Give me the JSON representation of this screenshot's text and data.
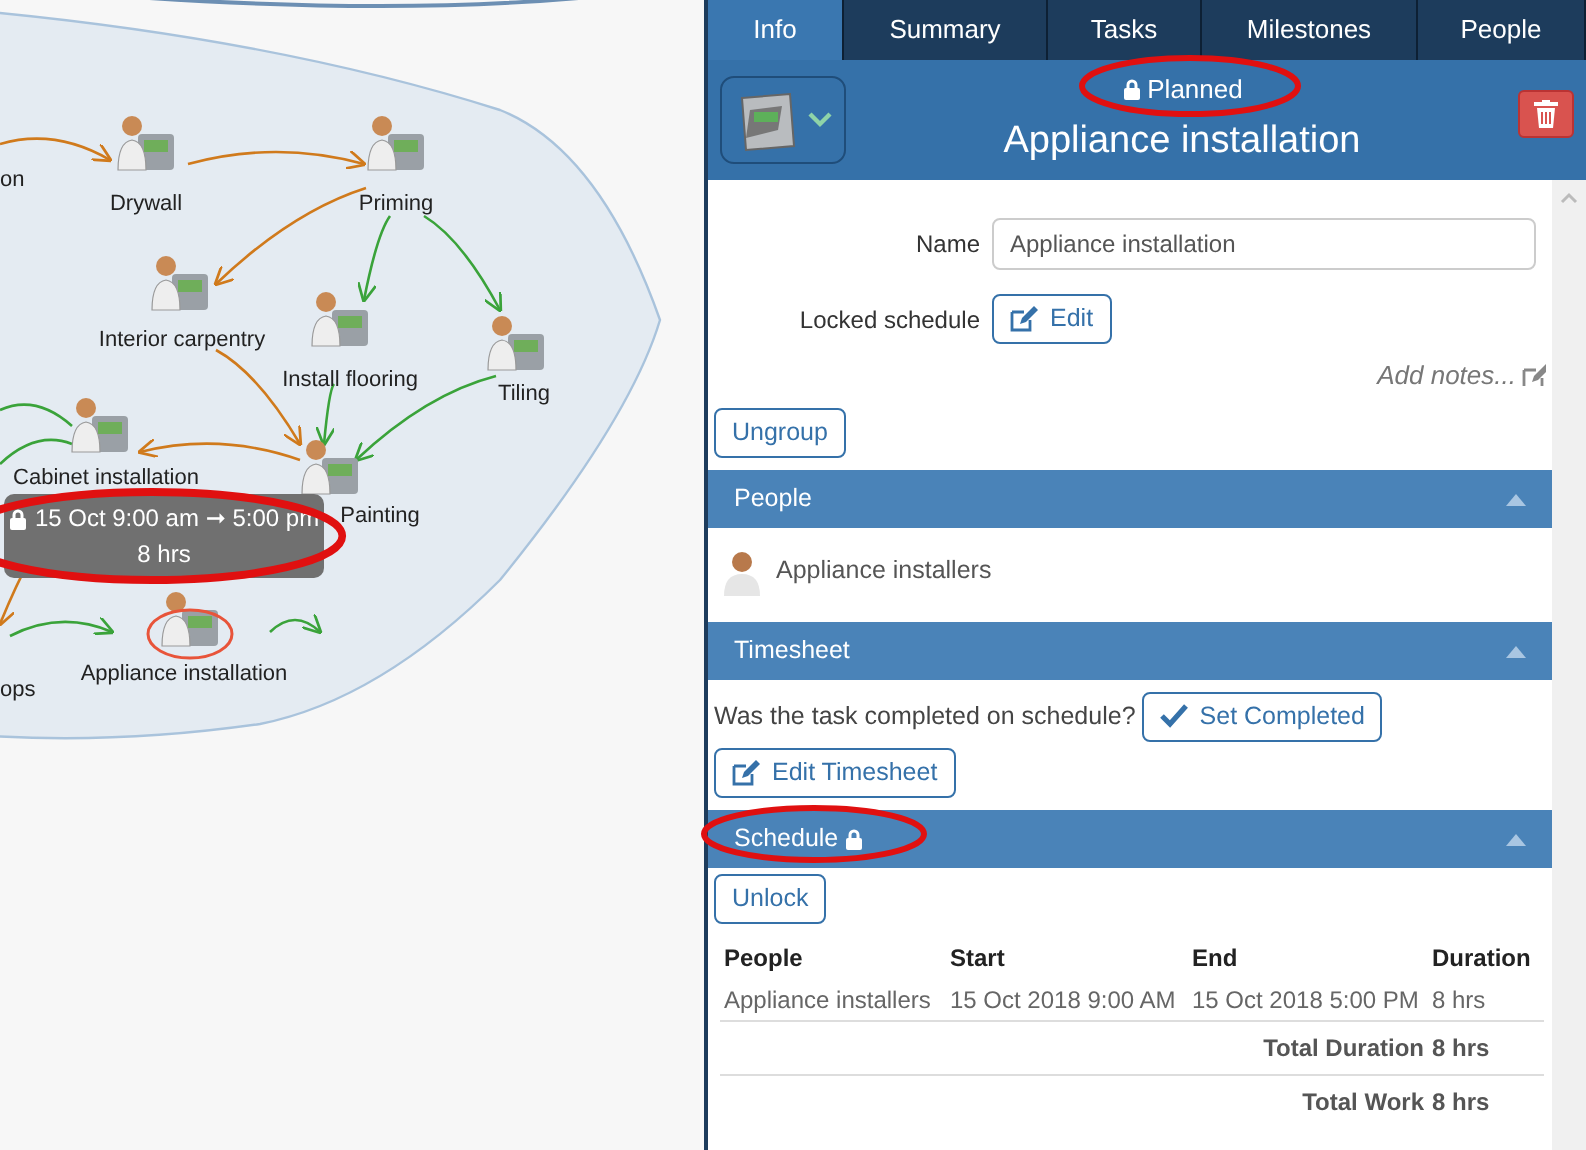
{
  "diagram": {
    "nodes": [
      {
        "label": "on",
        "selected": false
      },
      {
        "label": "Drywall",
        "selected": false
      },
      {
        "label": "Priming",
        "selected": false
      },
      {
        "label": "Interior carpentry",
        "selected": false
      },
      {
        "label": "Install flooring",
        "selected": false
      },
      {
        "label": "Tiling",
        "selected": false
      },
      {
        "label": "Cabinet installation",
        "selected": false
      },
      {
        "label": "Painting",
        "selected": false
      },
      {
        "label": "Appliance installation",
        "selected": true
      },
      {
        "label": "ops",
        "selected": false
      }
    ],
    "tooltip": {
      "locked": true,
      "lines": [
        "15 Oct 9:00 am ➞ 5:00 pm",
        "8 hrs"
      ]
    }
  },
  "panel": {
    "tabs": [
      {
        "label": "Info",
        "selected": true
      },
      {
        "label": "Summary",
        "selected": false
      },
      {
        "label": "Tasks",
        "selected": false
      },
      {
        "label": "Milestones",
        "selected": false
      },
      {
        "label": "People",
        "selected": false
      }
    ],
    "header": {
      "status": "Planned",
      "locked": true,
      "title": "Appliance installation"
    },
    "form": {
      "name_label": "Name",
      "name_value": "Appliance installation",
      "locked_label": "Locked schedule",
      "edit_button": "Edit",
      "notes_placeholder": "Add notes...",
      "ungroup_button": "Ungroup"
    },
    "sections": [
      {
        "kind": "people",
        "title": "People",
        "locked": false,
        "expanded": true,
        "people": [
          "Appliance installers"
        ]
      },
      {
        "kind": "timesheet",
        "title": "Timesheet",
        "locked": false,
        "expanded": true,
        "question": "Was the task completed on schedule?",
        "complete_button": "Set Completed",
        "edit_button": "Edit Timesheet"
      },
      {
        "kind": "schedule",
        "title": "Schedule",
        "locked": true,
        "expanded": true,
        "unlock_button": "Unlock",
        "table": {
          "columns": [
            "People",
            "Start",
            "End",
            "Duration"
          ],
          "rows": [
            [
              "Appliance installers",
              "15 Oct 2018 9:00 AM",
              "15 Oct 2018 5:00 PM",
              "8 hrs"
            ]
          ],
          "totals": [
            {
              "label": "Total Duration",
              "value": "8 hrs"
            },
            {
              "label": "Total Work",
              "value": "8 hrs"
            }
          ]
        }
      }
    ]
  }
}
